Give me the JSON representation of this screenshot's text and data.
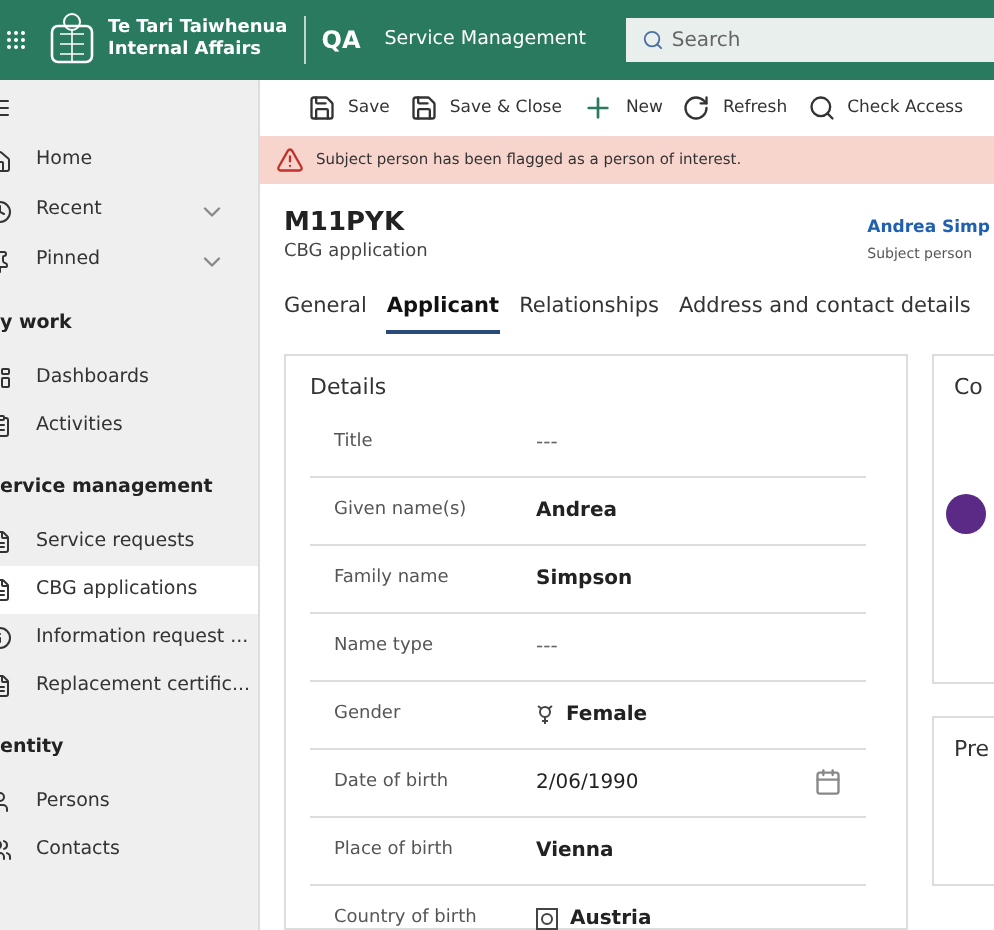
{
  "header": {
    "org_line1": "Te Tari Taiwhenua",
    "org_line2": "Internal Affairs",
    "env": "QA",
    "app": "Service Management",
    "search": {
      "placeholder": "Search"
    }
  },
  "sidebar": {
    "top": [
      {
        "label": "Home",
        "chevron": false
      },
      {
        "label": "Recent",
        "chevron": true
      },
      {
        "label": "Pinned",
        "chevron": true
      }
    ],
    "groups": [
      {
        "title": "y work",
        "items": [
          {
            "label": "Dashboards",
            "selected": false
          },
          {
            "label": "Activities",
            "selected": false
          }
        ]
      },
      {
        "title": "ervice management",
        "items": [
          {
            "label": "Service requests",
            "selected": false
          },
          {
            "label": "CBG applications",
            "selected": true
          },
          {
            "label": "Information request ...",
            "selected": false
          },
          {
            "label": "Replacement certific...",
            "selected": false
          }
        ]
      },
      {
        "title": "entity",
        "items": [
          {
            "label": "Persons",
            "selected": false
          },
          {
            "label": "Contacts",
            "selected": false
          }
        ]
      }
    ]
  },
  "toolbar": [
    {
      "kind": "save",
      "label": "Save"
    },
    {
      "kind": "save-close",
      "label": "Save & Close"
    },
    {
      "kind": "new",
      "label": "New"
    },
    {
      "kind": "refresh",
      "label": "Refresh"
    },
    {
      "kind": "check",
      "label": "Check Access"
    }
  ],
  "alert": "Subject person has been flagged as a person of interest.",
  "record": {
    "title": "M11PYK",
    "subtitle": "CBG application",
    "subject_link": "Andrea Simp",
    "subject_caption": "Subject person"
  },
  "tabs": [
    {
      "label": "General",
      "selected": false
    },
    {
      "label": "Applicant",
      "selected": true
    },
    {
      "label": "Relationships",
      "selected": false
    },
    {
      "label": "Address and contact details",
      "selected": false
    }
  ],
  "details": {
    "title": "Details",
    "fields": [
      {
        "label": "Title",
        "value": "---",
        "kind": "empty"
      },
      {
        "label": "Given name(s)",
        "value": "Andrea",
        "kind": "text"
      },
      {
        "label": "Family name",
        "value": "Simpson",
        "kind": "text"
      },
      {
        "label": "Name type",
        "value": "---",
        "kind": "empty"
      },
      {
        "label": "Gender",
        "value": "Female",
        "kind": "gender"
      },
      {
        "label": "Date of birth",
        "value": "2/06/1990",
        "kind": "date"
      },
      {
        "label": "Place of birth",
        "value": "Vienna",
        "kind": "text"
      },
      {
        "label": "Country of birth",
        "value": "Austria",
        "kind": "country"
      }
    ]
  },
  "side_cards": [
    {
      "title": "Co",
      "kind": "avatar"
    },
    {
      "title": "Pre",
      "kind": "plain"
    }
  ]
}
